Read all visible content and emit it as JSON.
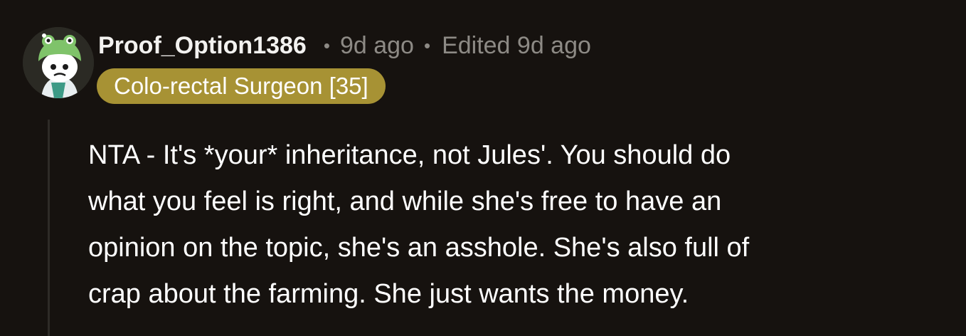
{
  "comment": {
    "author": "Proof_Option1386",
    "avatar_icon": "snoo-frog-hat-avatar",
    "separator": "•",
    "age": "9d ago",
    "edited": "Edited 9d ago",
    "flair": "Colo-rectal Surgeon [35]",
    "flair_color": "#a79234",
    "lines": [
      "NTA - It's *your* inheritance, not Jules'. You should do",
      "what you feel is right, and while she's free to have an",
      "opinion on the topic, she's an asshole. She's also full of",
      "crap about the farming. She just wants the money."
    ]
  }
}
